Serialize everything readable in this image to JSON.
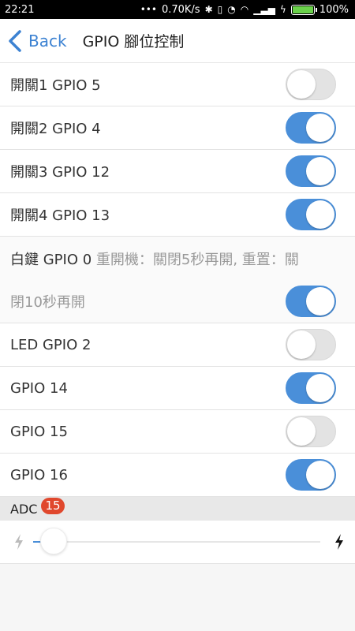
{
  "status_bar": {
    "time": "22:21",
    "network_speed": "0.70K/s",
    "battery": "100%"
  },
  "nav": {
    "back_label": "Back",
    "title": "GPIO 腳位控制"
  },
  "switches": [
    {
      "label": "開關1 GPIO 5",
      "on": false
    },
    {
      "label": "開關2 GPIO 4",
      "on": true
    },
    {
      "label": "開關3 GPIO 12",
      "on": true
    },
    {
      "label": "開關4 GPIO 13",
      "on": true
    }
  ],
  "white_key": {
    "prefix": "白鍵 GPIO 0",
    "note": " 重開機：關閉5秒再開, 重置：關",
    "second_line": "閉10秒再開",
    "on": true
  },
  "switches2": [
    {
      "label": "LED GPIO 2",
      "on": false
    },
    {
      "label": "GPIO 14",
      "on": true
    },
    {
      "label": "GPIO 15",
      "on": false
    },
    {
      "label": "GPIO 16",
      "on": true
    }
  ],
  "adc": {
    "label": "ADC",
    "value": "15",
    "level_percent": 4
  },
  "colors": {
    "accent": "#4a8fd9",
    "badge": "#e0482d",
    "back": "#3c82d2"
  }
}
